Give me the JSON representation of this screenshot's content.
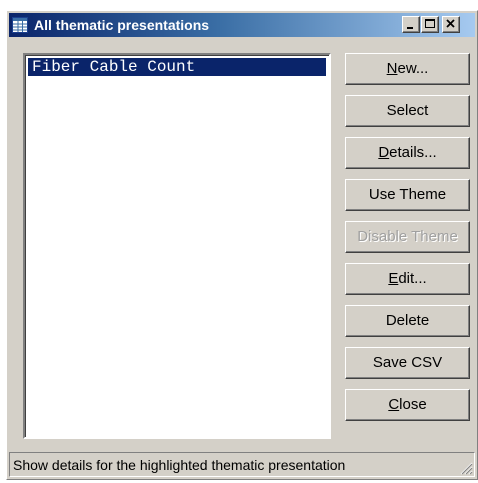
{
  "window": {
    "title": "All thematic presentations",
    "icon": "table-icon"
  },
  "list": {
    "items": [
      {
        "label": "Fiber Cable Count",
        "selected": true
      }
    ]
  },
  "buttons": {
    "new": {
      "pre": "",
      "mnemonic": "N",
      "post": "ew...",
      "enabled": true
    },
    "select": {
      "label": "Select",
      "enabled": true
    },
    "details": {
      "pre": "",
      "mnemonic": "D",
      "post": "etails...",
      "enabled": true
    },
    "use_theme": {
      "label": "Use Theme",
      "enabled": true
    },
    "disable_theme": {
      "label": "Disable Theme",
      "enabled": false
    },
    "edit": {
      "pre": "",
      "mnemonic": "E",
      "post": "dit...",
      "enabled": true
    },
    "delete": {
      "label": "Delete",
      "enabled": true
    },
    "save_csv": {
      "label": "Save CSV",
      "enabled": true
    },
    "close": {
      "pre": "",
      "mnemonic": "C",
      "post": "lose",
      "enabled": true
    }
  },
  "status": {
    "text": "Show details for the highlighted thematic presentation"
  },
  "colors": {
    "selection": "#0a246a",
    "face": "#d4d0c8",
    "title_start": "#0a246a",
    "title_end": "#a6caf0"
  }
}
